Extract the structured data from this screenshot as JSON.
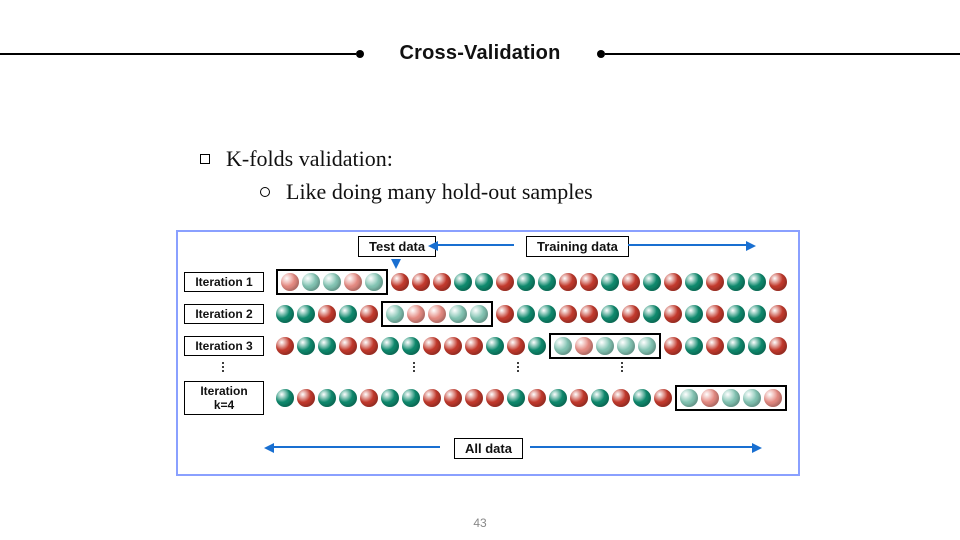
{
  "title": "Cross-Validation",
  "bullets": {
    "main": "K-folds validation:",
    "sub": "Like doing many hold-out samples"
  },
  "diagram": {
    "test_label": "Test data",
    "train_label": "Training data",
    "all_label": "All data",
    "iterations": [
      "Iteration 1",
      "Iteration 2",
      "Iteration 3",
      "Iteration k=4"
    ],
    "rows": [
      {
        "before": [],
        "test": [
          "pr",
          "pg",
          "pg",
          "pr",
          "pg"
        ],
        "after": [
          "r",
          "r",
          "r",
          "g",
          "g",
          "r",
          "g",
          "g",
          "r",
          "r",
          "g",
          "r",
          "g",
          "r",
          "g",
          "r",
          "g",
          "g",
          "r"
        ]
      },
      {
        "before": [
          "g",
          "g",
          "r",
          "g",
          "r"
        ],
        "test": [
          "pg",
          "pr",
          "pr",
          "pg",
          "pg"
        ],
        "after": [
          "r",
          "g",
          "g",
          "r",
          "r",
          "g",
          "r",
          "g",
          "r",
          "g",
          "r",
          "g",
          "g",
          "r"
        ]
      },
      {
        "before": [
          "r",
          "g",
          "g",
          "r",
          "r",
          "g",
          "g",
          "r",
          "r",
          "r",
          "g",
          "r",
          "g"
        ],
        "test": [
          "pg",
          "pr",
          "pg",
          "pg",
          "pg"
        ],
        "after": [
          "r",
          "g",
          "r",
          "g",
          "g",
          "r"
        ]
      },
      {
        "before": [
          "g",
          "r",
          "g",
          "g",
          "r",
          "g",
          "g",
          "r",
          "r",
          "r",
          "r",
          "g",
          "r",
          "g",
          "r",
          "g",
          "r",
          "g",
          "r"
        ],
        "test": [
          "pg",
          "pr",
          "pg",
          "pg",
          "pr"
        ],
        "after": []
      }
    ]
  },
  "page_number": "43"
}
